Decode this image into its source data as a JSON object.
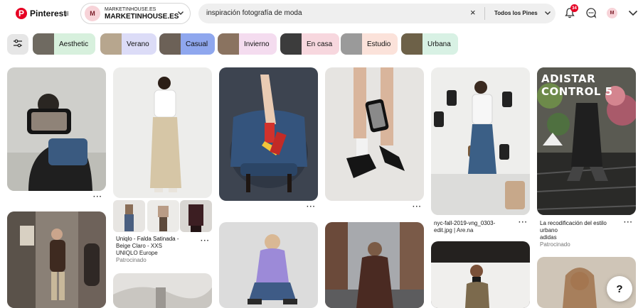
{
  "header": {
    "logo_text": "Pinterest",
    "logo_glyph": "P",
    "menu_icon": "≡",
    "account": {
      "avatar_initial": "M",
      "small_name": "MARKETINHOUSE.ES",
      "big_name": "MARKETINHOUSE.ES"
    },
    "search": {
      "value": "inspiración fotografía de moda",
      "filter_label": "Todos los Pines",
      "clear_icon": "×"
    },
    "notifications_count": "34",
    "user_initial": "M"
  },
  "chips": [
    {
      "label": "Aesthetic",
      "bg": "#d7f0dd",
      "thumb": "#6f6a61"
    },
    {
      "label": "Verano",
      "bg": "#dcdcf7",
      "thumb": "#b7a68e"
    },
    {
      "label": "Casual",
      "bg": "#8fa7ee",
      "thumb": "#6c6157"
    },
    {
      "label": "Invierno",
      "bg": "#f4dcef",
      "thumb": "#8a7360"
    },
    {
      "label": "En casa",
      "bg": "#f7d7de",
      "thumb": "#3c3c3c"
    },
    {
      "label": "Estudio",
      "bg": "#fbe2da",
      "thumb": "#9a9a9a"
    },
    {
      "label": "Urbana",
      "bg": "#d8f1e4",
      "thumb": "#6d6148"
    }
  ],
  "pins": {
    "p2_caption": {
      "title_1": "Uniqlo - Falda Satinada -",
      "title_2": "Beige Claro - XXS",
      "source": "UNIQLO Europe",
      "sponsored": "Patrocinado"
    },
    "p5_caption": {
      "title_1": "nyc-fall-2019-vng_0303-",
      "title_2": "edit.jpg | Are.na"
    },
    "p6_caption": {
      "title_1": "La recodificación del estilo",
      "title_2": "urbano",
      "source": "adidas",
      "sponsored": "Patrocinado"
    },
    "p6_overlay": "ADISTAR CONTROL 5",
    "more_glyph": "···"
  },
  "help_glyph": "?",
  "colors": {
    "brand": "#e60023"
  }
}
